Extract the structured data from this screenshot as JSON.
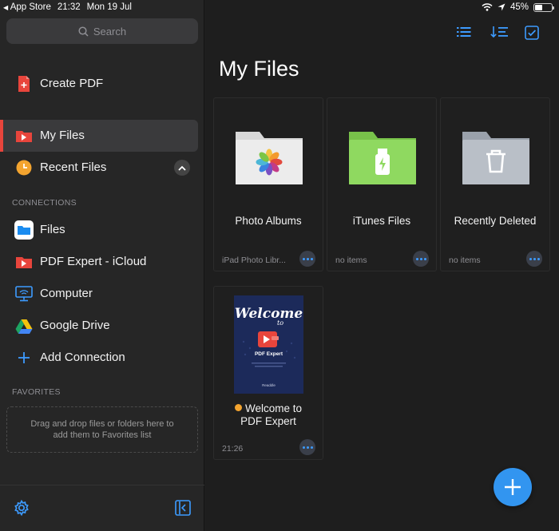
{
  "status_bar": {
    "back_app": "App Store",
    "time": "21:32",
    "date": "Mon 19 Jul",
    "battery": "45%",
    "battery_level": 0.45
  },
  "sidebar": {
    "search_placeholder": "Search",
    "create_pdf": "Create PDF",
    "items": [
      {
        "label": "My Files",
        "icon": "pdf-expert-folder-icon",
        "active": true
      },
      {
        "label": "Recent Files",
        "icon": "clock-icon"
      }
    ],
    "connections_heading": "CONNECTIONS",
    "connections": [
      {
        "label": "Files",
        "icon": "files-app-icon"
      },
      {
        "label": "PDF Expert - iCloud",
        "icon": "pdf-expert-icloud-icon"
      },
      {
        "label": "Computer",
        "icon": "computer-icon"
      },
      {
        "label": "Google Drive",
        "icon": "google-drive-icon"
      },
      {
        "label": "Add Connection",
        "icon": "plus-icon"
      }
    ],
    "favorites_heading": "FAVORITES",
    "favorites_hint": "Drag and drop files or folders here to add them to Favorites list"
  },
  "main": {
    "title": "My Files",
    "cards": [
      {
        "name": "Photo Albums",
        "meta": "iPad Photo Libr...",
        "icon": "photos-folder-icon"
      },
      {
        "name": "iTunes Files",
        "meta": "no items",
        "icon": "itunes-usb-folder-icon"
      },
      {
        "name": "Recently Deleted",
        "meta": "no items",
        "icon": "trash-folder-icon"
      }
    ],
    "document": {
      "name_line1": "Welcome to",
      "name_line2": "PDF Expert",
      "meta": "21:26",
      "thumb_title": "Welcome",
      "thumb_to": "to",
      "thumb_app": "PDF Expert",
      "thumb_brand": "Readdle"
    }
  },
  "colors": {
    "accent": "#3295f0",
    "active_marker": "#e8453c",
    "unread_dot": "#f3a42f"
  }
}
